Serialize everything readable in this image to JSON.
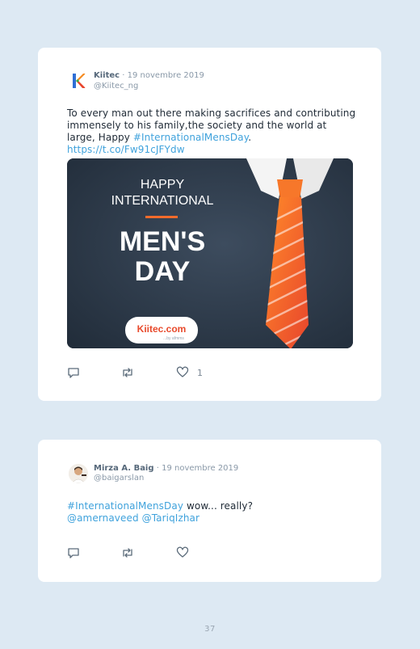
{
  "tweets": [
    {
      "author": "Kiitec",
      "date": "19 novembre 2019",
      "handle": "@Kiitec_ng",
      "text_plain": "To every man out there making sacrifices and contributing immensely to his family,the society and the world at large, Happy ",
      "hashtag": "#InternationalMensDay",
      "separator": ". ",
      "url": "https://t.co/Fw91cJFYdw",
      "media": {
        "line1": "HAPPY",
        "line2": "INTERNATIONAL",
        "line3": "MEN'S",
        "line4": "DAY",
        "badge_brand": "Kiitec.com",
        "badge_sub": "...by afmms"
      },
      "likes": "1"
    },
    {
      "author": "Mirza A. Baig",
      "date": "19 novembre 2019",
      "handle": "@baigarslan",
      "hashtag": "#InternationalMensDay",
      "text_plain": " wow... really?",
      "mention1": "@amernaveed",
      "mention2": "@TariqIzhar"
    }
  ],
  "page_number": "37",
  "colors": {
    "background": "#dde9f3",
    "card": "#ffffff",
    "link": "#3fa2dc",
    "text": "#1f2a36",
    "muted": "#8a99a8",
    "tie": "#f26b2b"
  },
  "icons": [
    "reply-icon",
    "retweet-icon",
    "heart-icon"
  ]
}
